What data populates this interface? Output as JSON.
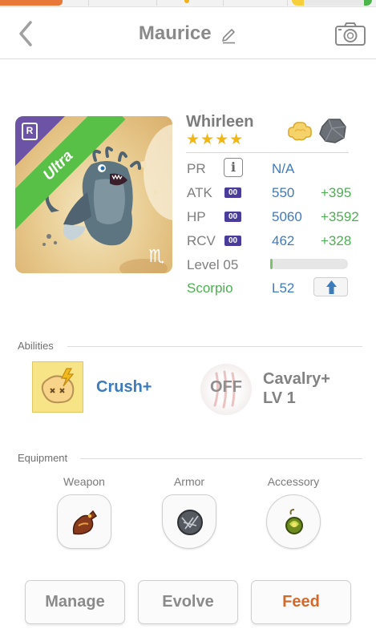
{
  "header": {
    "title": "Maurice",
    "back_icon": "chevron-left-icon",
    "edit_icon": "pencil-icon",
    "camera_icon": "camera-icon"
  },
  "monster": {
    "name": "Whirleen",
    "stars": "★★★★",
    "rarity_badge": "R",
    "ribbon": "Ultra",
    "zodiac_glyph": "♏",
    "element_icon": "cloud-icon",
    "class_icon": "rock-icon",
    "stats": {
      "pr": {
        "label": "PR",
        "value": "N/A"
      },
      "atk": {
        "label": "ATK",
        "badge": "00",
        "value": "550",
        "bonus": "+395"
      },
      "hp": {
        "label": "HP",
        "badge": "00",
        "value": "5060",
        "bonus": "+3592"
      },
      "rcv": {
        "label": "RCV",
        "badge": "00",
        "value": "462",
        "bonus": "+328"
      }
    },
    "level_label": "Level 05",
    "level_progress": 0.03,
    "zodiac": "Scorpio",
    "zodiac_level": "L52"
  },
  "abilities": {
    "section_label": "Abilities",
    "items": [
      {
        "name": "Crush+"
      },
      {
        "name_line1": "Cavalry+",
        "name_line2": "LV 1",
        "status": "OFF"
      }
    ]
  },
  "equipment": {
    "section_label": "Equipment",
    "slots": [
      {
        "label": "Weapon"
      },
      {
        "label": "Armor"
      },
      {
        "label": "Accessory"
      }
    ]
  },
  "actions": {
    "manage": "Manage",
    "evolve": "Evolve",
    "feed": "Feed"
  },
  "colors": {
    "accent_blue": "#3e7bbd",
    "bonus_green": "#4caf50",
    "feed_orange": "#d4692a",
    "star_gold": "#f0b714"
  }
}
